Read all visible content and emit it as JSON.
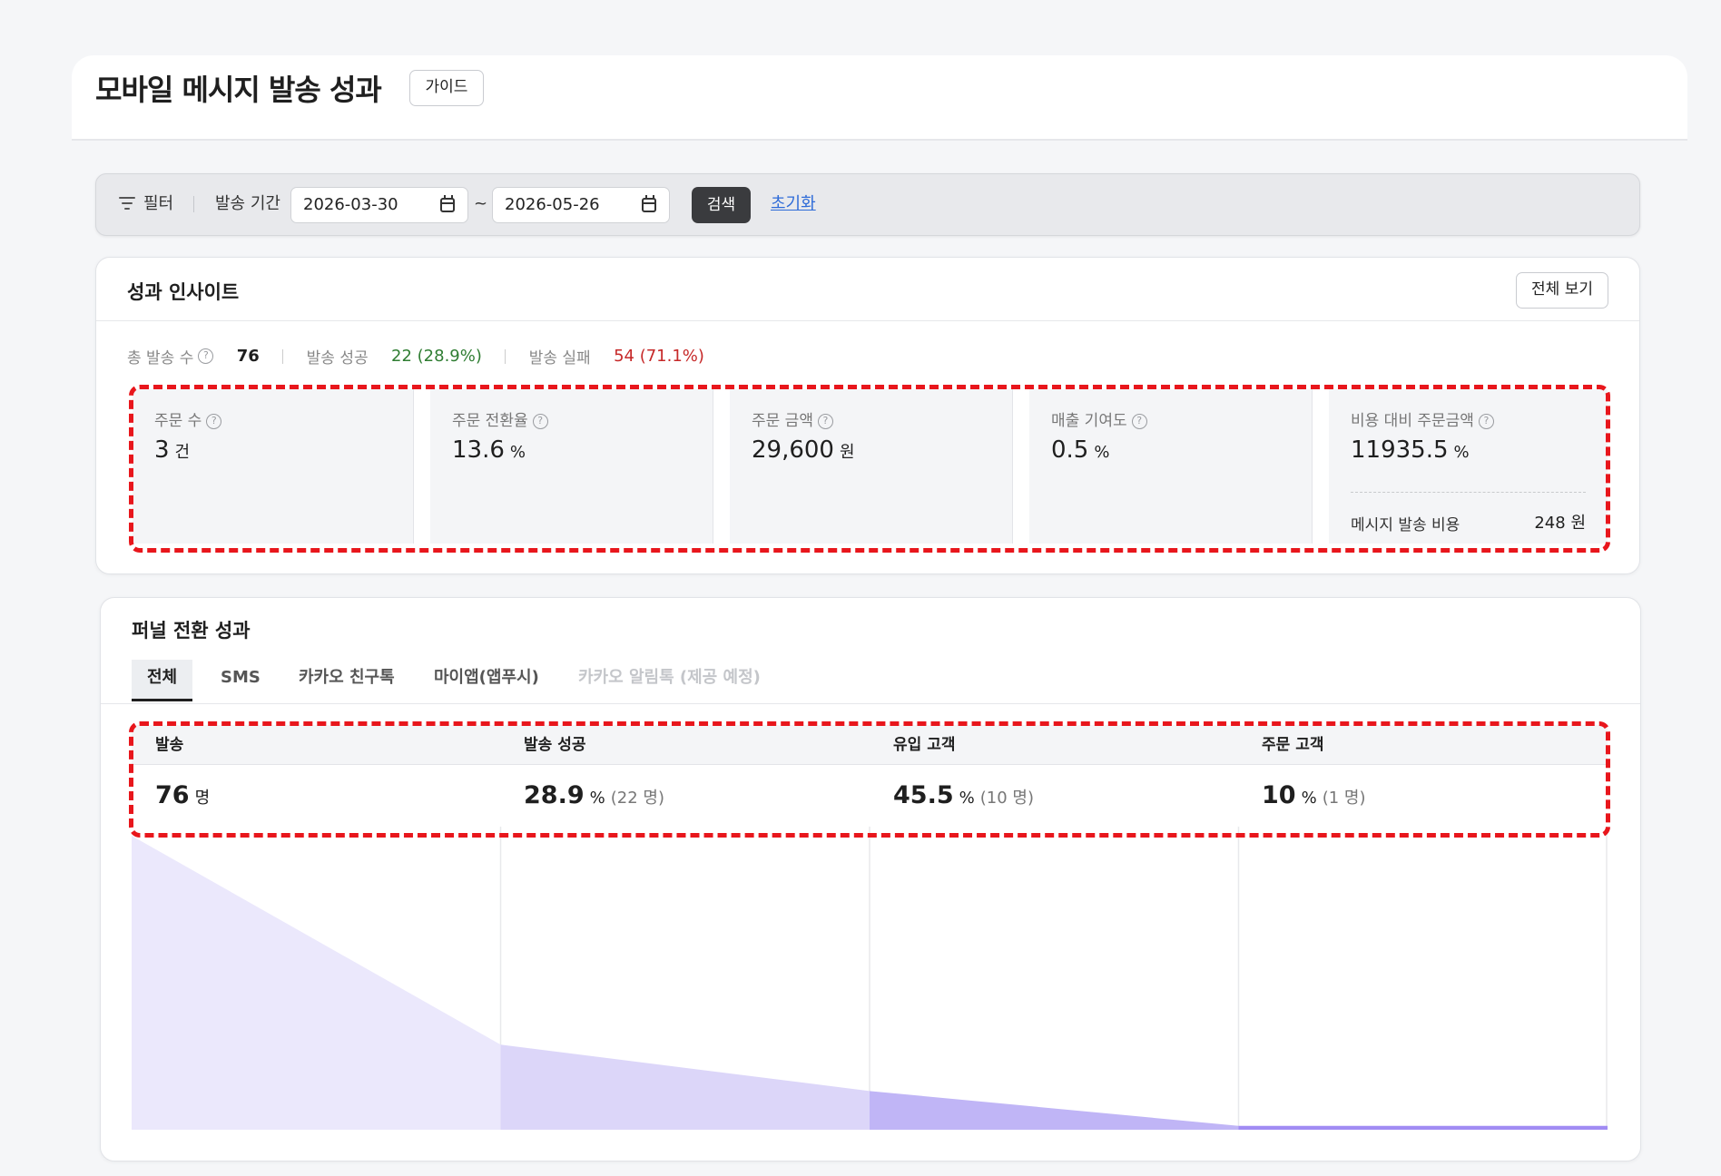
{
  "header": {
    "title": "모바일 메시지 발송 성과",
    "guide_label": "가이드"
  },
  "filter": {
    "filter_label": "필터",
    "period_label": "발송 기간",
    "start_date": "2026-03-30",
    "range_sep": "~",
    "end_date": "2026-05-26",
    "search_label": "검색",
    "reset_label": "초기화"
  },
  "insight": {
    "title": "성과 인사이트",
    "view_all_label": "전체 보기",
    "summary": {
      "total_label": "총 발송 수",
      "total_value": "76",
      "success_label": "발송 성공",
      "success_value": "22 (28.9%)",
      "fail_label": "발송 실패",
      "fail_value": "54 (71.1%)"
    },
    "metrics": [
      {
        "label": "주문 수",
        "value": "3",
        "unit": "건"
      },
      {
        "label": "주문 전환율",
        "value": "13.6",
        "unit": "%"
      },
      {
        "label": "주문 금액",
        "value": "29,600",
        "unit": "원"
      },
      {
        "label": "매출 기여도",
        "value": "0.5",
        "unit": "%"
      },
      {
        "label": "비용 대비 주문금액",
        "value": "11935.5",
        "unit": "%",
        "cost_label": "메시지 발송 비용",
        "cost_value": "248 원"
      }
    ]
  },
  "funnel": {
    "title": "퍼널 전환 성과",
    "tabs": [
      {
        "label": "전체",
        "active": true
      },
      {
        "label": "SMS"
      },
      {
        "label": "카카오 친구톡"
      },
      {
        "label": "마이앱(앱푸시)"
      },
      {
        "label": "카카오 알림톡 (제공 예정)",
        "disabled": true
      }
    ],
    "columns": [
      {
        "header": "발송",
        "value": "76",
        "unit": "명",
        "sub": ""
      },
      {
        "header": "발송 성공",
        "value": "28.9",
        "unit": "%",
        "sub": "(22 명)"
      },
      {
        "header": "유입 고객",
        "value": "45.5",
        "unit": "%",
        "sub": "(10 명)"
      },
      {
        "header": "주문 고객",
        "value": "10",
        "unit": "%",
        "sub": "(1 명)"
      }
    ],
    "colors": [
      "#ebe8fc",
      "#dcd6f9",
      "#c0b5f6",
      "#a18cf3"
    ]
  },
  "chart_data": {
    "type": "area",
    "categories": [
      "발송",
      "발송 성공",
      "유입 고객",
      "주문 고객"
    ],
    "values": [
      76,
      22,
      10,
      1
    ]
  }
}
